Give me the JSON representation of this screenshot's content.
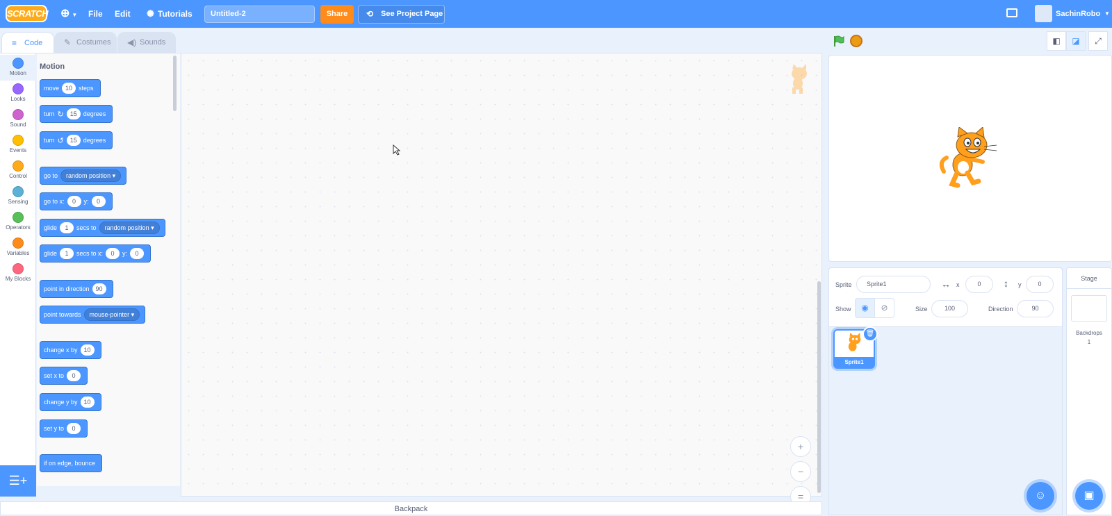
{
  "menubar": {
    "logo": "SCRATCH",
    "file": "File",
    "edit": "Edit",
    "tutorials": "Tutorials",
    "project_title": "Untitled-2",
    "share": "Share",
    "see_project_page": "See Project Page",
    "username": "SachinRobo",
    "brand_color": "#4c97ff"
  },
  "tabs": {
    "code": "Code",
    "costumes": "Costumes",
    "sounds": "Sounds"
  },
  "categories": [
    {
      "label": "Motion",
      "color": "#4c97ff"
    },
    {
      "label": "Looks",
      "color": "#9966ff"
    },
    {
      "label": "Sound",
      "color": "#cf63cf"
    },
    {
      "label": "Events",
      "color": "#ffbf00"
    },
    {
      "label": "Control",
      "color": "#ffab19"
    },
    {
      "label": "Sensing",
      "color": "#5cb1d6"
    },
    {
      "label": "Operators",
      "color": "#59c059"
    },
    {
      "label": "Variables",
      "color": "#ff8c1a"
    },
    {
      "label": "My Blocks",
      "color": "#ff6680"
    }
  ],
  "palette": {
    "title": "Motion",
    "move": {
      "a": "move",
      "v": "10",
      "b": "steps"
    },
    "turn_cw": {
      "a": "turn",
      "v": "15",
      "b": "degrees"
    },
    "turn_ccw": {
      "a": "turn",
      "v": "15",
      "b": "degrees"
    },
    "go_to": {
      "a": "go to",
      "d": "random position"
    },
    "go_to_xy": {
      "a": "go to x:",
      "x": "0",
      "b": "y:",
      "y": "0"
    },
    "glide_to": {
      "a": "glide",
      "v": "1",
      "b": "secs to",
      "d": "random position"
    },
    "glide_xy": {
      "a": "glide",
      "v": "1",
      "b": "secs to x:",
      "x": "0",
      "c": "y:",
      "y": "0"
    },
    "point_dir": {
      "a": "point in direction",
      "v": "90"
    },
    "point_towards": {
      "a": "point towards",
      "d": "mouse-pointer"
    },
    "change_x": {
      "a": "change x by",
      "v": "10"
    },
    "set_x": {
      "a": "set x to",
      "v": "0"
    },
    "change_y": {
      "a": "change y by",
      "v": "10"
    },
    "set_y": {
      "a": "set y to",
      "v": "0"
    },
    "bounce": {
      "a": "if on edge, bounce"
    }
  },
  "zoom": {
    "in": "+",
    "out": "−",
    "reset": "="
  },
  "backpack": "Backpack",
  "sprite_info": {
    "sprite_label": "Sprite",
    "sprite_name": "Sprite1",
    "x_label": "x",
    "x_value": "0",
    "y_label": "y",
    "y_value": "0",
    "show_label": "Show",
    "size_label": "Size",
    "size_value": "100",
    "direction_label": "Direction",
    "direction_value": "90"
  },
  "sprites": [
    {
      "name": "Sprite1"
    }
  ],
  "stage_pane": {
    "title": "Stage",
    "backdrops_label": "Backdrops",
    "backdrops_count": "1"
  }
}
